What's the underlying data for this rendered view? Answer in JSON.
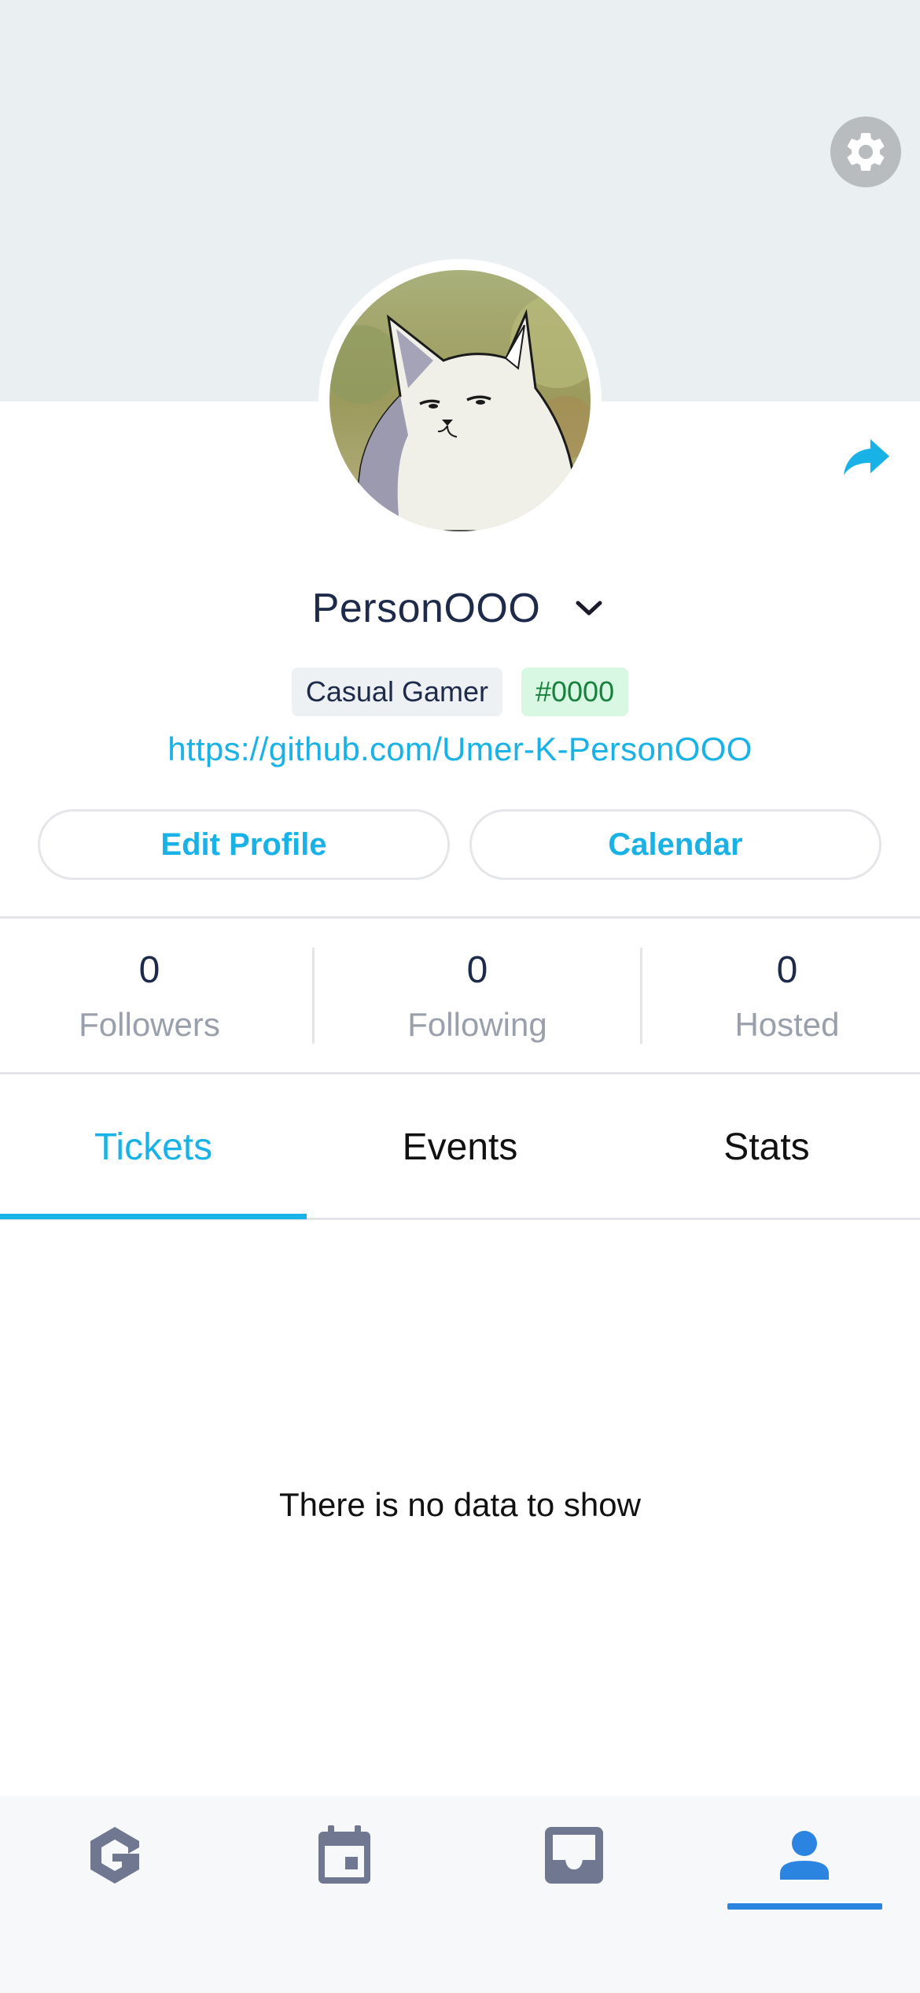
{
  "profile": {
    "username": "PersonOOO",
    "badge_level": "Casual Gamer",
    "badge_tag": "#0000",
    "link": "https://github.com/Umer-K-PersonOOO"
  },
  "actions": {
    "edit_profile": "Edit Profile",
    "calendar": "Calendar"
  },
  "stats": [
    {
      "value": "0",
      "label": "Followers"
    },
    {
      "value": "0",
      "label": "Following"
    },
    {
      "value": "0",
      "label": "Hosted"
    }
  ],
  "tabs": [
    {
      "label": "Tickets",
      "active": true
    },
    {
      "label": "Events",
      "active": false
    },
    {
      "label": "Stats",
      "active": false
    }
  ],
  "empty_message": "There is no data to show",
  "icons": {
    "settings": "gear-icon",
    "share": "share-icon",
    "username_menu": "chevron-down-icon",
    "nav": [
      "logo-g-icon",
      "calendar-icon",
      "inbox-icon",
      "person-icon"
    ]
  },
  "colors": {
    "accent": "#19b2e6",
    "nav_active": "#2a84e0",
    "nav_inactive": "#6f7791",
    "cover": "#eaeff2",
    "badge_green_bg": "#d9f8e4"
  }
}
